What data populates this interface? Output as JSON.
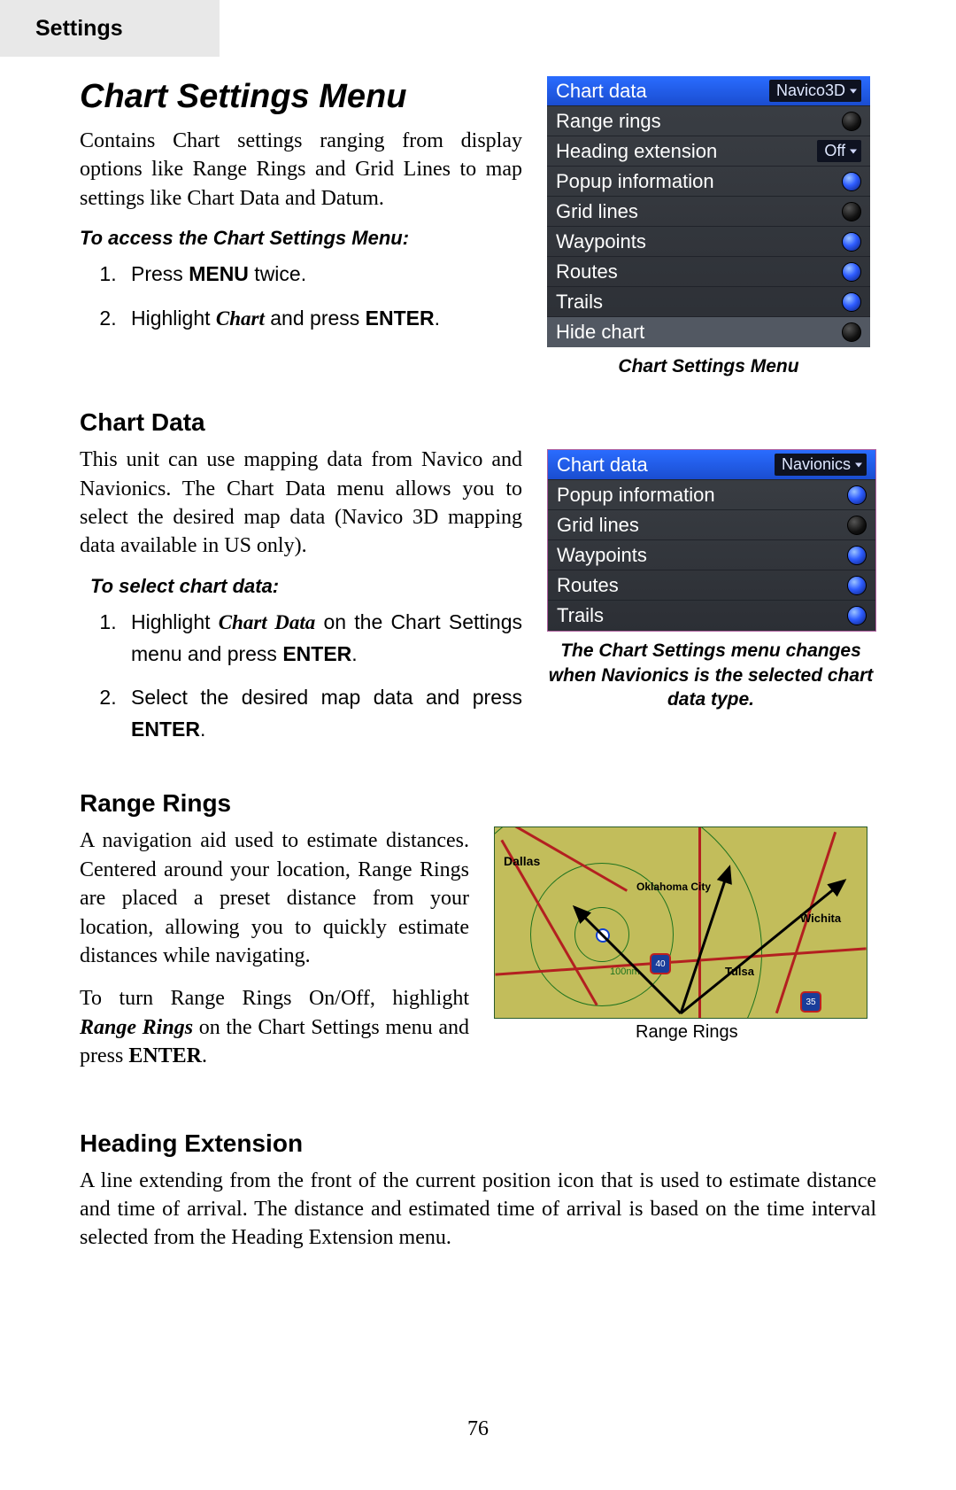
{
  "header_tab": "Settings",
  "section_title": "Chart Settings Menu",
  "intro": "Contains Chart settings ranging from display options like Range Rings and Grid Lines to map settings like Chart Data and Datum.",
  "access_lead": "To access the Chart Settings Menu:",
  "access_steps": {
    "s1_a": "Press ",
    "s1_b": "MENU",
    "s1_c": " twice.",
    "s2_a": "Highlight ",
    "s2_b": "Chart",
    "s2_c": " and press ",
    "s2_d": "ENTER",
    "s2_e": "."
  },
  "menu1": {
    "caption": "Chart Settings Menu",
    "rows": [
      {
        "label": "Chart data",
        "value": "Navico3D",
        "type": "select",
        "selected": true
      },
      {
        "label": "Range rings",
        "type": "orb",
        "on": false
      },
      {
        "label": "Heading extension",
        "value": "Off",
        "type": "select"
      },
      {
        "label": "Popup information",
        "type": "orb",
        "on": true
      },
      {
        "label": "Grid lines",
        "type": "orb",
        "on": false
      },
      {
        "label": "Waypoints",
        "type": "orb",
        "on": true
      },
      {
        "label": "Routes",
        "type": "orb",
        "on": true
      },
      {
        "label": "Trails",
        "type": "orb",
        "on": true
      },
      {
        "label": "Hide chart",
        "type": "orb",
        "on": false,
        "hide": true
      }
    ]
  },
  "chartdata_head": "Chart Data",
  "chartdata_body": "This unit can use mapping data from Navico and Navionics. The Chart Data menu allows you to select the desired map data (Navico 3D mapping data available in US only).",
  "select_lead": "To select chart data:",
  "select_steps": {
    "s1_a": "Highlight ",
    "s1_b": "Chart Data",
    "s1_c": " on the Chart Settings menu and press ",
    "s1_d": "ENTER",
    "s1_e": ".",
    "s2_a": "Select the desired map data and press ",
    "s2_b": "ENTER",
    "s2_c": "."
  },
  "menu2": {
    "caption": "The Chart Settings menu changes when Navionics is the selected chart data type.",
    "rows": [
      {
        "label": "Chart data",
        "value": "Navionics",
        "type": "select",
        "selected": true
      },
      {
        "label": "Popup information",
        "type": "orb",
        "on": true
      },
      {
        "label": "Grid lines",
        "type": "orb",
        "on": false
      },
      {
        "label": "Waypoints",
        "type": "orb",
        "on": true
      },
      {
        "label": "Routes",
        "type": "orb",
        "on": true
      },
      {
        "label": "Trails",
        "type": "orb",
        "on": true
      }
    ]
  },
  "rr_head": "Range Rings",
  "rr_body1": "A navigation aid used to estimate distances. Centered around your location, Range Rings are placed a preset distance from your location, allowing you to quickly estimate distances while navigating.",
  "rr_body2_a": "To turn Range Rings On/Off, highlight ",
  "rr_body2_b": "Range Rings",
  "rr_body2_c": " on the Chart Settings menu and press ",
  "rr_body2_d": "ENTER",
  "rr_body2_e": ".",
  "map": {
    "caption": "Range Rings",
    "cities": {
      "dallas": "Dallas",
      "okc": "Oklahoma City",
      "tulsa": "Tulsa",
      "wichita": "Wichita"
    },
    "range_label": "100nm"
  },
  "he_head": "Heading Extension",
  "he_body": "A line extending from the front of the current position icon that is used to estimate distance and time of arrival. The distance and estimated time of arrival is based on the time interval selected from the Heading Extension menu.",
  "page_number": "76"
}
